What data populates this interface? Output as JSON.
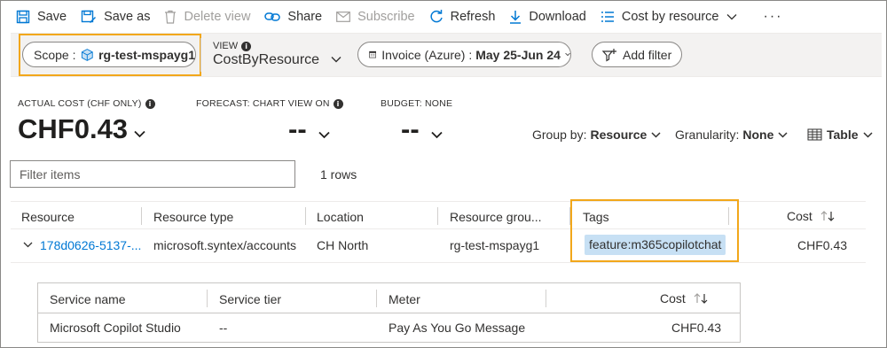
{
  "toolbar": {
    "save": "Save",
    "save_as": "Save as",
    "delete_view": "Delete view",
    "share": "Share",
    "subscribe": "Subscribe",
    "refresh": "Refresh",
    "download": "Download",
    "view_selector": "Cost by resource",
    "more": "···"
  },
  "filterbar": {
    "scope_label": "Scope :",
    "scope_value": "rg-test-mspayg1",
    "view_label": "VIEW",
    "view_name": "CostByResource",
    "date_label": "Invoice (Azure) :",
    "date_value": "May 25-Jun 24",
    "add_filter": "Add filter"
  },
  "kpis": {
    "actual_label": "ACTUAL COST (CHF ONLY)",
    "actual_value": "CHF0.43",
    "forecast_label": "FORECAST: CHART VIEW ON",
    "forecast_value": "--",
    "budget_label": "BUDGET: NONE",
    "budget_value": "--"
  },
  "controls": {
    "group_by_label": "Group by:",
    "group_by_value": "Resource",
    "granularity_label": "Granularity:",
    "granularity_value": "None",
    "view_type": "Table"
  },
  "filter": {
    "placeholder": "Filter items",
    "rows": "1 rows"
  },
  "table": {
    "headers": [
      "Resource",
      "Resource type",
      "Location",
      "Resource grou...",
      "Tags",
      "Cost"
    ],
    "row": {
      "resource": "178d0626-5137-...",
      "type": "microsoft.syntex/accounts",
      "location": "CH North",
      "group": "rg-test-mspayg1",
      "tag": "feature:m365copilotchat",
      "cost": "CHF0.43"
    }
  },
  "subtable": {
    "headers": [
      "Service name",
      "Service tier",
      "Meter",
      "Cost"
    ],
    "row": {
      "service": "Microsoft Copilot Studio",
      "tier": "--",
      "meter": "Pay As You Go Message",
      "cost": "CHF0.43"
    }
  },
  "colors": {
    "accent": "#0078d4",
    "highlight": "#f2a71a",
    "tag_bg": "#c7e0f4"
  }
}
